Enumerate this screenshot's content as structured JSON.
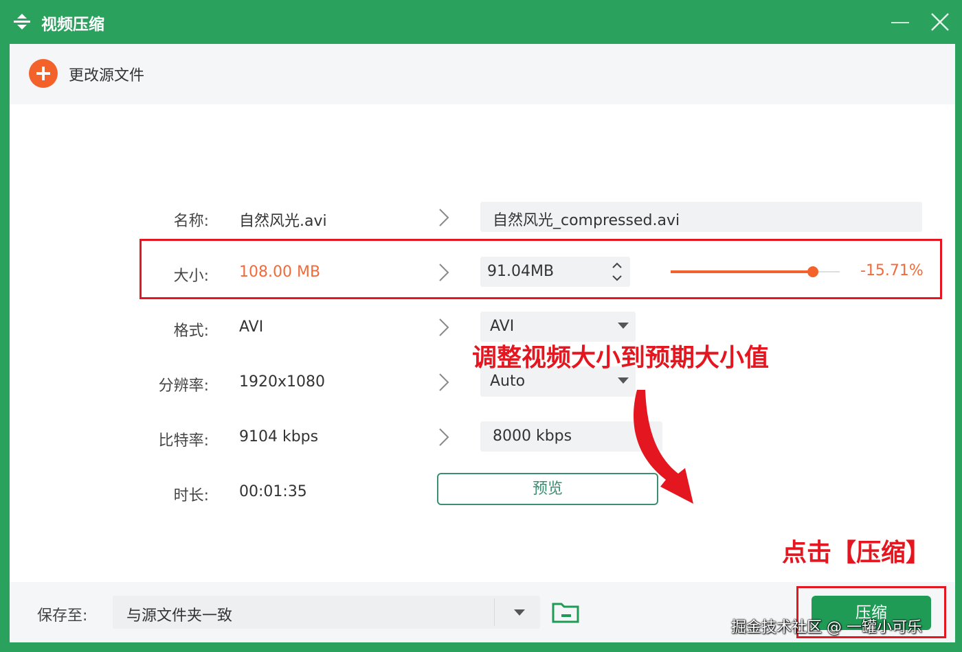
{
  "window": {
    "title": "视频压缩",
    "accent": "#2aa15d",
    "highlight": "#f3622a",
    "annotation_color": "#e4161f"
  },
  "toolbar": {
    "change_source_label": "更改源文件",
    "icon": "plus-circle-icon"
  },
  "fields": {
    "name": {
      "label": "名称:",
      "source": "自然风光.avi",
      "target": "自然风光_compressed.avi"
    },
    "size": {
      "label": "大小:",
      "source": "108.00 MB",
      "target": "91.04MB",
      "slider_fraction": 0.84,
      "percent": "-15.71%"
    },
    "format": {
      "label": "格式:",
      "source": "AVI",
      "target": "AVI"
    },
    "resolution": {
      "label": "分辨率:",
      "source": "1920x1080",
      "target": "Auto"
    },
    "bitrate": {
      "label": "比特率:",
      "source": "9104 kbps",
      "target": "8000 kbps"
    },
    "duration": {
      "label": "时长:",
      "source": "00:01:35"
    }
  },
  "preview_label": "预览",
  "annotations": {
    "adjust_hint": "调整视频大小到预期大小值",
    "click_hint": "点击【压缩】"
  },
  "bottom": {
    "save_label": "保存至:",
    "save_location": "与源文件夹一致",
    "compress_label": "压缩"
  },
  "watermark": "掘金技术社区 @ 一罐小可乐"
}
